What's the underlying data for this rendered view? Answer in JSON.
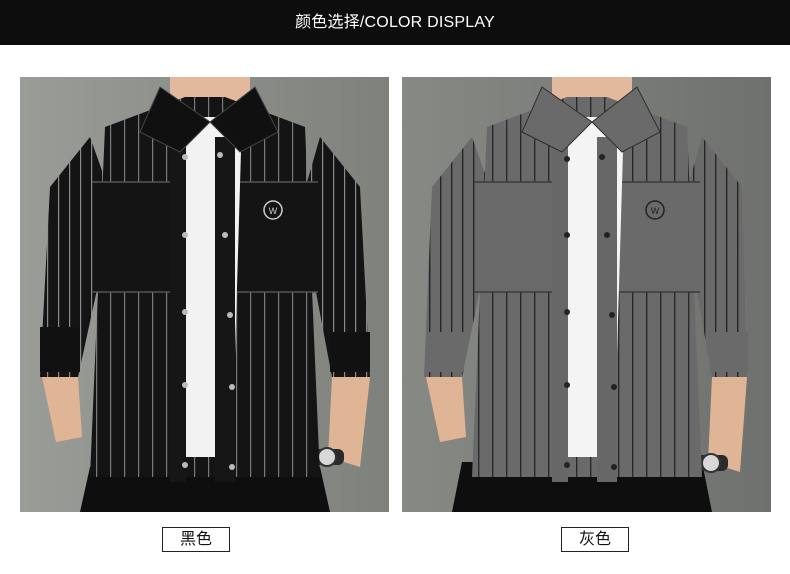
{
  "header": {
    "title": "颜色选择/COLOR DISPLAY"
  },
  "variants": [
    {
      "label": "黑色",
      "body_color": "#141414",
      "stripe_color": "#8a8a8a",
      "bg_color": "#8e908c"
    },
    {
      "label": "灰色",
      "body_color": "#6a6a6a",
      "stripe_color": "#262626",
      "bg_color": "#7c7e7b"
    }
  ],
  "colors": {
    "header_bg": "#0d0d0d",
    "header_text": "#ffffff",
    "page_bg": "#ffffff"
  },
  "icons": [
    "brand-logo-icon",
    "wristwatch-icon"
  ]
}
